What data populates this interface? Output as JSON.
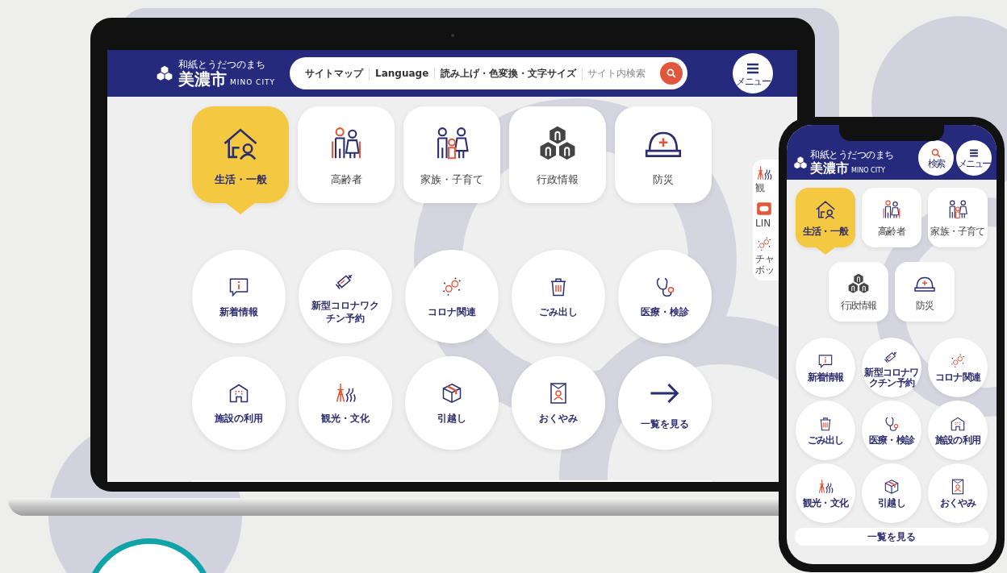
{
  "laptop": {
    "header": {
      "tagline": "和紙とうだつのまち",
      "logo": "美濃市",
      "logo_en": "MINO CITY",
      "links": [
        "サイトマップ",
        "Language",
        "読み上げ・色変換・文字サイズ"
      ],
      "search": {
        "placeholder": "サイト内検索"
      },
      "menu_label": "メニュー"
    },
    "categories": [
      {
        "label": "生活・一般",
        "kind": "house",
        "selected": true
      },
      {
        "label": "高齢者",
        "kind": "elderly",
        "selected": false
      },
      {
        "label": "家族・子育て",
        "kind": "family",
        "selected": false
      },
      {
        "label": "行政情報",
        "kind": "government",
        "selected": false
      },
      {
        "label": "防災",
        "kind": "helmet",
        "selected": false
      }
    ],
    "services": [
      {
        "label": "新着情報",
        "kind": "news"
      },
      {
        "label": "新型コロナワクチン予約",
        "kind": "syringe"
      },
      {
        "label": "コロナ関連",
        "kind": "virus"
      },
      {
        "label": "ごみ出し",
        "kind": "trash"
      },
      {
        "label": "医療・検診",
        "kind": "stethoscope"
      },
      {
        "label": "施設の利用",
        "kind": "building"
      },
      {
        "label": "観光・文化",
        "kind": "tower"
      },
      {
        "label": "引越し",
        "kind": "box"
      },
      {
        "label": "おくやみ",
        "kind": "memorial"
      },
      {
        "label": "一覧を見る",
        "kind": "arrow"
      }
    ],
    "side_panel": [
      {
        "lines": [
          "観"
        ],
        "kind": "tower"
      },
      {
        "lines": [
          "LIN"
        ],
        "kind": "chat"
      },
      {
        "lines": [
          "チャ",
          "ボッ"
        ],
        "kind": "virus"
      }
    ]
  },
  "phone": {
    "header": {
      "tagline": "和紙とうだつのまち",
      "logo": "美濃市",
      "logo_en": "MINO CITY",
      "search_label": "検索",
      "menu_label": "メニュー"
    },
    "categories": [
      {
        "label": "生活・一般",
        "kind": "house",
        "selected": true
      },
      {
        "label": "高齢者",
        "kind": "elderly",
        "selected": false
      },
      {
        "label": "家族・子育て",
        "kind": "family",
        "selected": false
      },
      {
        "label": "行政情報",
        "kind": "government",
        "selected": false
      },
      {
        "label": "防災",
        "kind": "helmet",
        "selected": false
      }
    ],
    "services": [
      {
        "label": "新着情報",
        "kind": "news"
      },
      {
        "label": "新型コロナワクチン予約",
        "kind": "syringe"
      },
      {
        "label": "コロナ関連",
        "kind": "virus"
      },
      {
        "label": "ごみ出し",
        "kind": "trash"
      },
      {
        "label": "医療・検診",
        "kind": "stethoscope"
      },
      {
        "label": "施設の利用",
        "kind": "building"
      },
      {
        "label": "観光・文化",
        "kind": "tower"
      },
      {
        "label": "引越し",
        "kind": "box"
      },
      {
        "label": "おくやみ",
        "kind": "memorial"
      }
    ],
    "more_button": "一覧を見る"
  }
}
